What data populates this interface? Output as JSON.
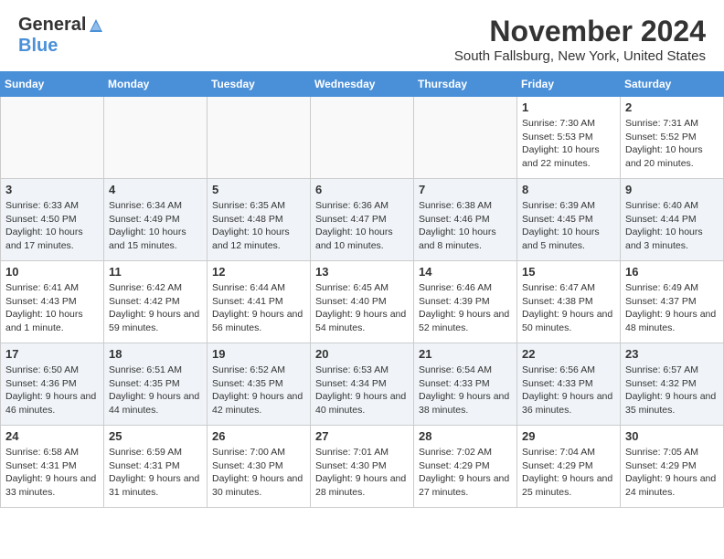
{
  "header": {
    "logo_general": "General",
    "logo_blue": "Blue",
    "month_title": "November 2024",
    "location": "South Fallsburg, New York, United States"
  },
  "weekdays": [
    "Sunday",
    "Monday",
    "Tuesday",
    "Wednesday",
    "Thursday",
    "Friday",
    "Saturday"
  ],
  "weeks": [
    [
      {
        "day": "",
        "info": ""
      },
      {
        "day": "",
        "info": ""
      },
      {
        "day": "",
        "info": ""
      },
      {
        "day": "",
        "info": ""
      },
      {
        "day": "",
        "info": ""
      },
      {
        "day": "1",
        "info": "Sunrise: 7:30 AM\nSunset: 5:53 PM\nDaylight: 10 hours and 22 minutes."
      },
      {
        "day": "2",
        "info": "Sunrise: 7:31 AM\nSunset: 5:52 PM\nDaylight: 10 hours and 20 minutes."
      }
    ],
    [
      {
        "day": "3",
        "info": "Sunrise: 6:33 AM\nSunset: 4:50 PM\nDaylight: 10 hours and 17 minutes."
      },
      {
        "day": "4",
        "info": "Sunrise: 6:34 AM\nSunset: 4:49 PM\nDaylight: 10 hours and 15 minutes."
      },
      {
        "day": "5",
        "info": "Sunrise: 6:35 AM\nSunset: 4:48 PM\nDaylight: 10 hours and 12 minutes."
      },
      {
        "day": "6",
        "info": "Sunrise: 6:36 AM\nSunset: 4:47 PM\nDaylight: 10 hours and 10 minutes."
      },
      {
        "day": "7",
        "info": "Sunrise: 6:38 AM\nSunset: 4:46 PM\nDaylight: 10 hours and 8 minutes."
      },
      {
        "day": "8",
        "info": "Sunrise: 6:39 AM\nSunset: 4:45 PM\nDaylight: 10 hours and 5 minutes."
      },
      {
        "day": "9",
        "info": "Sunrise: 6:40 AM\nSunset: 4:44 PM\nDaylight: 10 hours and 3 minutes."
      }
    ],
    [
      {
        "day": "10",
        "info": "Sunrise: 6:41 AM\nSunset: 4:43 PM\nDaylight: 10 hours and 1 minute."
      },
      {
        "day": "11",
        "info": "Sunrise: 6:42 AM\nSunset: 4:42 PM\nDaylight: 9 hours and 59 minutes."
      },
      {
        "day": "12",
        "info": "Sunrise: 6:44 AM\nSunset: 4:41 PM\nDaylight: 9 hours and 56 minutes."
      },
      {
        "day": "13",
        "info": "Sunrise: 6:45 AM\nSunset: 4:40 PM\nDaylight: 9 hours and 54 minutes."
      },
      {
        "day": "14",
        "info": "Sunrise: 6:46 AM\nSunset: 4:39 PM\nDaylight: 9 hours and 52 minutes."
      },
      {
        "day": "15",
        "info": "Sunrise: 6:47 AM\nSunset: 4:38 PM\nDaylight: 9 hours and 50 minutes."
      },
      {
        "day": "16",
        "info": "Sunrise: 6:49 AM\nSunset: 4:37 PM\nDaylight: 9 hours and 48 minutes."
      }
    ],
    [
      {
        "day": "17",
        "info": "Sunrise: 6:50 AM\nSunset: 4:36 PM\nDaylight: 9 hours and 46 minutes."
      },
      {
        "day": "18",
        "info": "Sunrise: 6:51 AM\nSunset: 4:35 PM\nDaylight: 9 hours and 44 minutes."
      },
      {
        "day": "19",
        "info": "Sunrise: 6:52 AM\nSunset: 4:35 PM\nDaylight: 9 hours and 42 minutes."
      },
      {
        "day": "20",
        "info": "Sunrise: 6:53 AM\nSunset: 4:34 PM\nDaylight: 9 hours and 40 minutes."
      },
      {
        "day": "21",
        "info": "Sunrise: 6:54 AM\nSunset: 4:33 PM\nDaylight: 9 hours and 38 minutes."
      },
      {
        "day": "22",
        "info": "Sunrise: 6:56 AM\nSunset: 4:33 PM\nDaylight: 9 hours and 36 minutes."
      },
      {
        "day": "23",
        "info": "Sunrise: 6:57 AM\nSunset: 4:32 PM\nDaylight: 9 hours and 35 minutes."
      }
    ],
    [
      {
        "day": "24",
        "info": "Sunrise: 6:58 AM\nSunset: 4:31 PM\nDaylight: 9 hours and 33 minutes."
      },
      {
        "day": "25",
        "info": "Sunrise: 6:59 AM\nSunset: 4:31 PM\nDaylight: 9 hours and 31 minutes."
      },
      {
        "day": "26",
        "info": "Sunrise: 7:00 AM\nSunset: 4:30 PM\nDaylight: 9 hours and 30 minutes."
      },
      {
        "day": "27",
        "info": "Sunrise: 7:01 AM\nSunset: 4:30 PM\nDaylight: 9 hours and 28 minutes."
      },
      {
        "day": "28",
        "info": "Sunrise: 7:02 AM\nSunset: 4:29 PM\nDaylight: 9 hours and 27 minutes."
      },
      {
        "day": "29",
        "info": "Sunrise: 7:04 AM\nSunset: 4:29 PM\nDaylight: 9 hours and 25 minutes."
      },
      {
        "day": "30",
        "info": "Sunrise: 7:05 AM\nSunset: 4:29 PM\nDaylight: 9 hours and 24 minutes."
      }
    ]
  ]
}
